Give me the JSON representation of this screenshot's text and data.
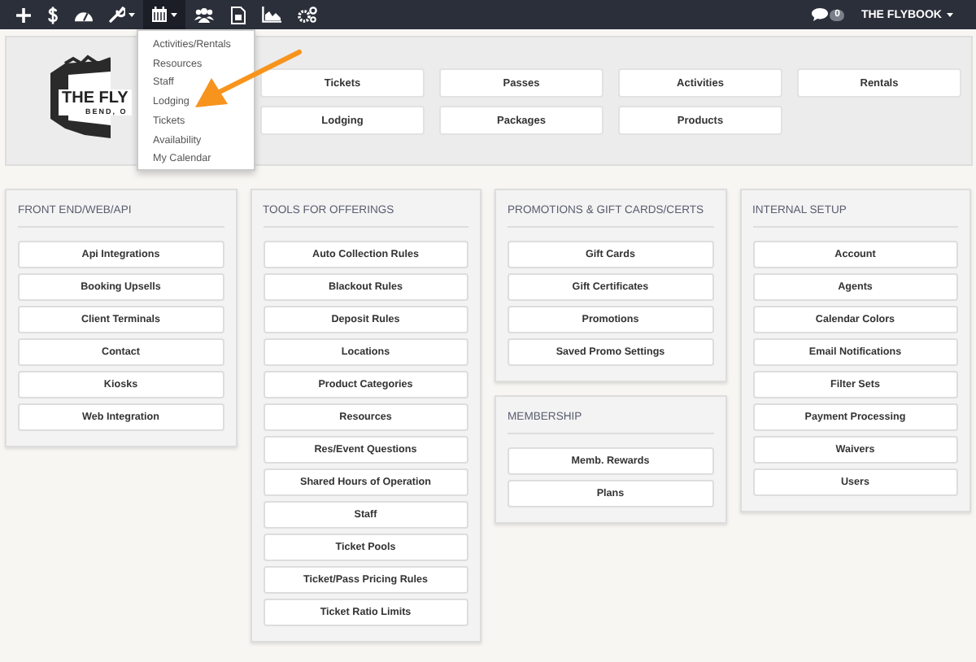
{
  "navbar": {
    "items": [
      {
        "kind": "plus",
        "caret": false,
        "selected": false
      },
      {
        "kind": "dollar",
        "caret": false,
        "selected": false
      },
      {
        "kind": "gauge",
        "caret": false,
        "selected": false
      },
      {
        "kind": "wrench",
        "caret": true,
        "selected": false
      },
      {
        "kind": "calendar",
        "caret": true,
        "selected": true
      },
      {
        "kind": "users",
        "caret": false,
        "selected": false
      },
      {
        "kind": "document",
        "caret": false,
        "selected": false
      },
      {
        "kind": "chart",
        "caret": false,
        "selected": false
      },
      {
        "kind": "gears",
        "caret": false,
        "selected": false
      }
    ],
    "messages_badge": "0",
    "account": "THE FLYBOOK"
  },
  "dropdown": [
    "Activities/Rentals",
    "Resources",
    "Staff",
    "Lodging",
    "Tickets",
    "Availability",
    "My Calendar"
  ],
  "logo": {
    "title": "THE FLY",
    "subtitle": "BEND, O"
  },
  "quick_links": [
    [
      "Tickets",
      "Passes",
      "Activities",
      "Rentals"
    ],
    [
      "Lodging",
      "Packages",
      "Products"
    ]
  ],
  "columns": [
    [
      {
        "title": "FRONT END/WEB/API",
        "buttons": [
          "Api Integrations",
          "Booking Upsells",
          "Client Terminals",
          "Contact",
          "Kiosks",
          "Web Integration"
        ]
      }
    ],
    [
      {
        "title": "TOOLS FOR OFFERINGS",
        "buttons": [
          "Auto Collection Rules",
          "Blackout Rules",
          "Deposit Rules",
          "Locations",
          "Product Categories",
          "Resources",
          "Res/Event Questions",
          "Shared Hours of Operation",
          "Staff",
          "Ticket Pools",
          "Ticket/Pass Pricing Rules",
          "Ticket Ratio Limits"
        ]
      }
    ],
    [
      {
        "title": "PROMOTIONS & GIFT CARDS/CERTS",
        "buttons": [
          "Gift Cards",
          "Gift Certificates",
          "Promotions",
          "Saved Promo Settings"
        ]
      },
      {
        "title": "MEMBERSHIP",
        "buttons": [
          "Memb. Rewards",
          "Plans"
        ]
      }
    ],
    [
      {
        "title": "INTERNAL SETUP",
        "buttons": [
          "Account",
          "Agents",
          "Calendar Colors",
          "Email Notifications",
          "Filter Sets",
          "Payment Processing",
          "Waivers",
          "Users"
        ]
      }
    ]
  ]
}
